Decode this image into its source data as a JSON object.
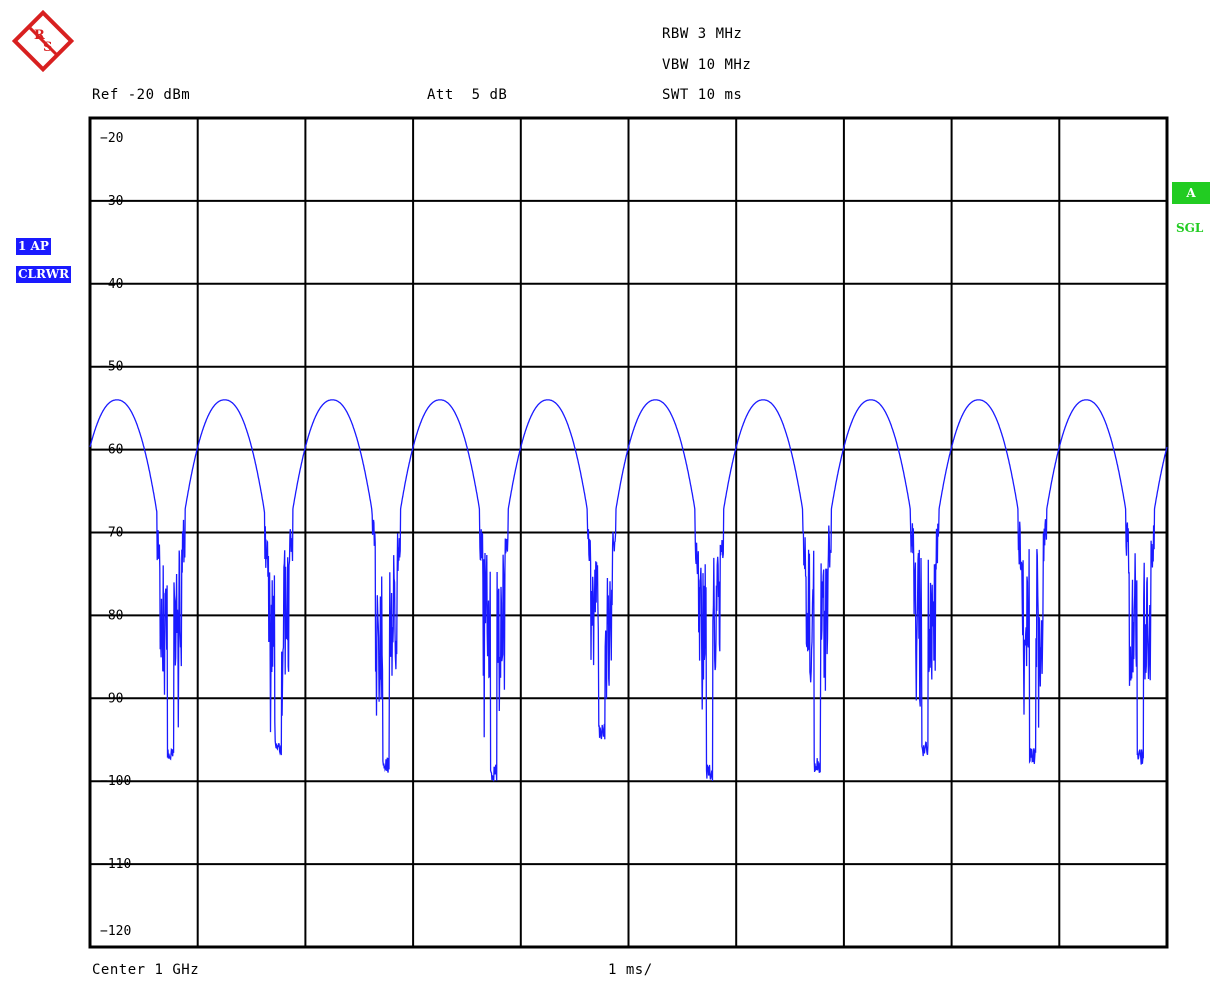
{
  "logo_text": "RS",
  "header": {
    "rbw": "RBW 3 MHz",
    "vbw": "VBW 10 MHz",
    "swt": "SWT 10 ms",
    "ref": "Ref -20 dBm",
    "att": "Att  5 dB"
  },
  "footer": {
    "center": "Center 1 GHz",
    "span_per_div": "1 ms/"
  },
  "trace_info": {
    "label": "1 AP",
    "mode": "CLRWR"
  },
  "status": {
    "trace_badge": "A",
    "sweep": "SGL"
  },
  "colors": {
    "trace": "#1a1aff",
    "grid": "#000000",
    "status_green": "#22cc22"
  },
  "chart_data": {
    "type": "line",
    "ylim": [
      -120,
      -20
    ],
    "y_ticks": [
      -20,
      -30,
      -40,
      -50,
      -60,
      -70,
      -80,
      -90,
      -100,
      -110,
      -120
    ],
    "x_divisions": 10,
    "x_unit_per_div": "1 ms",
    "x_range_ms": [
      0,
      10
    ],
    "grid": true,
    "series": [
      {
        "color": "#1a1aff",
        "pattern": "periodic_arches",
        "arches": 10,
        "period_ms": 1.0,
        "peak_dbm": -54,
        "arch_width_ms": 0.8,
        "arch_base_dbm": -70,
        "null_min_dbm": [
          -98,
          -97,
          -99,
          -100,
          -95,
          -100,
          -99,
          -97,
          -98,
          -98
        ],
        "noise_floor_dbm": [
          -72,
          -88
        ]
      }
    ]
  }
}
